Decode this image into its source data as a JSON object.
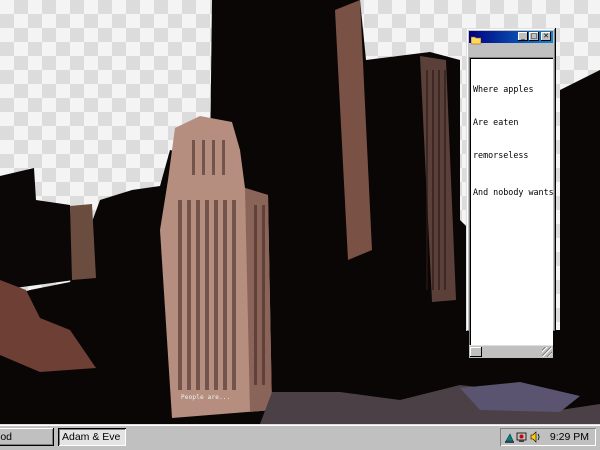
{
  "desktop": {
    "wallpaper_caption": "People are..."
  },
  "window": {
    "title": "",
    "controls": {
      "minimize": "_",
      "maximize": "□",
      "close": "✕"
    },
    "lines": [
      "Where apples",
      "Are eaten",
      "remorseless",
      "And nobody wants"
    ],
    "icons": {
      "app": "folder-icon"
    }
  },
  "taskbar": {
    "tasks": [
      "iod",
      "Adam & Eve"
    ],
    "active_task": "Adam & Eve",
    "tray_icons": [
      "network-icon",
      "monitor-icon",
      "volume-icon"
    ],
    "clock": "9:29 PM"
  },
  "colors": {
    "titlebar": "#000080",
    "face": "#c0c0c0"
  }
}
